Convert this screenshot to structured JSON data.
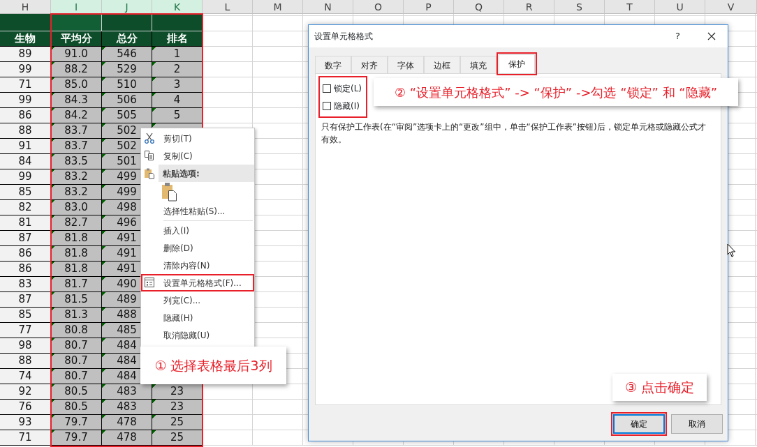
{
  "sheet": {
    "columns": [
      {
        "letter": "H",
        "selected": false
      },
      {
        "letter": "I",
        "selected": true
      },
      {
        "letter": "J",
        "selected": true
      },
      {
        "letter": "K",
        "selected": true
      },
      {
        "letter": "L",
        "selected": false
      },
      {
        "letter": "M",
        "selected": false
      },
      {
        "letter": "N",
        "selected": false
      },
      {
        "letter": "O",
        "selected": false
      },
      {
        "letter": "P",
        "selected": false
      },
      {
        "letter": "Q",
        "selected": false
      },
      {
        "letter": "R",
        "selected": false
      },
      {
        "letter": "S",
        "selected": false
      },
      {
        "letter": "T",
        "selected": false
      },
      {
        "letter": "U",
        "selected": false
      },
      {
        "letter": "V",
        "selected": false
      }
    ],
    "headers": [
      "生物",
      "平均分",
      "总分",
      "排名"
    ],
    "selection_outline": true,
    "rows": [
      {
        "biology": "89",
        "average": "91.0",
        "total": "546",
        "rank": "1"
      },
      {
        "biology": "99",
        "average": "88.2",
        "total": "529",
        "rank": "2"
      },
      {
        "biology": "71",
        "average": "85.0",
        "total": "510",
        "rank": "3"
      },
      {
        "biology": "99",
        "average": "84.3",
        "total": "506",
        "rank": "4"
      },
      {
        "biology": "86",
        "average": "84.2",
        "total": "505",
        "rank": "5"
      },
      {
        "biology": "88",
        "average": "83.7",
        "total": "502"
      },
      {
        "biology": "91",
        "average": "83.7",
        "total": "502"
      },
      {
        "biology": "84",
        "average": "83.5",
        "total": "501"
      },
      {
        "biology": "99",
        "average": "83.2",
        "total": "499"
      },
      {
        "biology": "85",
        "average": "83.2",
        "total": "499"
      },
      {
        "biology": "82",
        "average": "83.0",
        "total": "498"
      },
      {
        "biology": "81",
        "average": "82.7",
        "total": "496"
      },
      {
        "biology": "87",
        "average": "81.8",
        "total": "491"
      },
      {
        "biology": "86",
        "average": "81.8",
        "total": "491"
      },
      {
        "biology": "86",
        "average": "81.8",
        "total": "491"
      },
      {
        "biology": "83",
        "average": "81.7",
        "total": "490"
      },
      {
        "biology": "87",
        "average": "81.5",
        "total": "489"
      },
      {
        "biology": "85",
        "average": "81.3",
        "total": "488"
      },
      {
        "biology": "77",
        "average": "80.8",
        "total": "485"
      },
      {
        "biology": "98",
        "average": "80.7",
        "total": "484"
      },
      {
        "biology": "88",
        "average": "80.7",
        "total": "484"
      },
      {
        "biology": "74",
        "average": "80.7",
        "total": "484"
      },
      {
        "biology": "92",
        "average": "80.5",
        "total": "483",
        "rank": "23"
      },
      {
        "biology": "76",
        "average": "80.5",
        "total": "483",
        "rank": "23"
      },
      {
        "biology": "93",
        "average": "79.7",
        "total": "478",
        "rank": "25"
      },
      {
        "biology": "71",
        "average": "79.7",
        "total": "478",
        "rank": "25"
      }
    ]
  },
  "context_menu": {
    "items": [
      {
        "kind": "item",
        "label": "剪切(T)",
        "highlighted": false
      },
      {
        "kind": "item",
        "label": "复制(C)",
        "highlighted": false
      },
      {
        "kind": "header",
        "label": "粘贴选项:"
      },
      {
        "kind": "paste-option"
      },
      {
        "kind": "item",
        "label": "选择性粘贴(S)...",
        "highlighted": false
      },
      {
        "kind": "separator"
      },
      {
        "kind": "item",
        "label": "插入(I)",
        "highlighted": false
      },
      {
        "kind": "item",
        "label": "删除(D)",
        "highlighted": false
      },
      {
        "kind": "item",
        "label": "清除内容(N)",
        "highlighted": false
      },
      {
        "kind": "item",
        "label": "设置单元格格式(F)...",
        "highlighted": true
      },
      {
        "kind": "item",
        "label": "列宽(C)...",
        "highlighted": false
      },
      {
        "kind": "item",
        "label": "隐藏(H)",
        "highlighted": false
      },
      {
        "kind": "item",
        "label": "取消隐藏(U)",
        "highlighted": false
      }
    ]
  },
  "dialog": {
    "title": "设置单元格格式",
    "help": "?",
    "tabs": [
      {
        "label": "数字",
        "selected": false
      },
      {
        "label": "对齐",
        "selected": false
      },
      {
        "label": "字体",
        "selected": false
      },
      {
        "label": "边框",
        "selected": false
      },
      {
        "label": "填充",
        "selected": false
      },
      {
        "label": "保护",
        "selected": true
      }
    ],
    "checkboxes_highlighted": true,
    "checkboxes": [
      {
        "label": "锁定(L)",
        "checked": false
      },
      {
        "label": "隐藏(I)",
        "checked": false
      }
    ],
    "description": "只有保护工作表(在“审阅”选项卡上的“更改”组中，单击“保护工作表”按钮)后，锁定单元格或隐藏公式才有效。",
    "buttons": [
      {
        "label": "确定",
        "highlighted": true
      },
      {
        "label": "取消",
        "highlighted": false
      }
    ]
  },
  "callouts": [
    "① 选择表格最后3列",
    "② “设置单元格格式” -> “保护” ->勾选 “锁定” 和 “隐藏”",
    "③ 点击确定"
  ]
}
